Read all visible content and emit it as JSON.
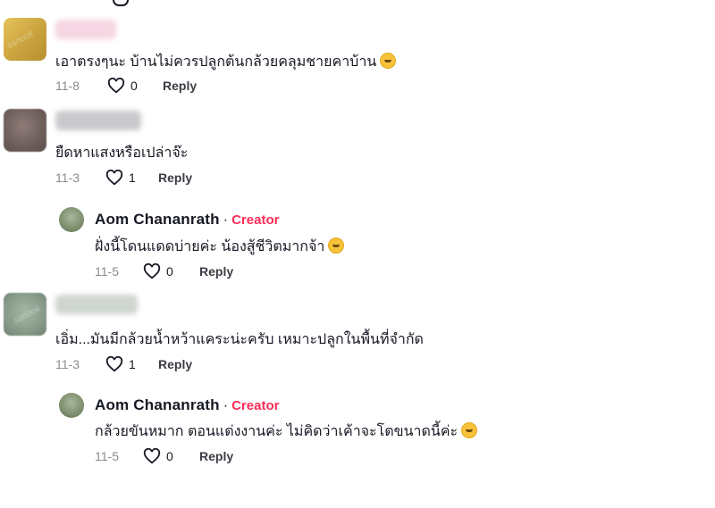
{
  "comments": [
    {
      "text": "เอาตรงๆนะ บ้านไม่ควรปลูกต้นกล้วยคลุมชายคาบ้าน",
      "emoji": "flushed-face-emoji",
      "date": "11-8",
      "likes": "0",
      "reply": "Reply"
    },
    {
      "text": "ยืดหาแสงหรือเปล่าจ๊ะ",
      "date": "11-3",
      "likes": "1",
      "reply": "Reply"
    },
    {
      "author": "Aom Chananrath",
      "separator": "·",
      "badge": "Creator",
      "text": "ฝั่งนี้โดนแดดบ่ายค่ะ น้องสู้ชีวิตมากจ้า",
      "emoji": "sweat-smile-emoji",
      "date": "11-5",
      "likes": "0",
      "reply": "Reply"
    },
    {
      "text": "เอิ่ม...มันมีกล้วยน้ำหว้าแคระน่ะครับ เหมาะปลูกในพื้นที่จำกัด",
      "date": "11-3",
      "likes": "1",
      "reply": "Reply"
    },
    {
      "author": "Aom Chananrath",
      "separator": "·",
      "badge": "Creator",
      "text": "กล้วยขันหมาก ตอนแต่งงานค่ะ ไม่คิดว่าเค้าจะโตขนาดนี้ค่ะ",
      "emoji": "sweat-smile-emoji",
      "date": "11-5",
      "likes": "0",
      "reply": "Reply"
    }
  ],
  "colors": {
    "creator": "#fe2c55",
    "text": "#161823",
    "meta": "#8a8b91"
  }
}
